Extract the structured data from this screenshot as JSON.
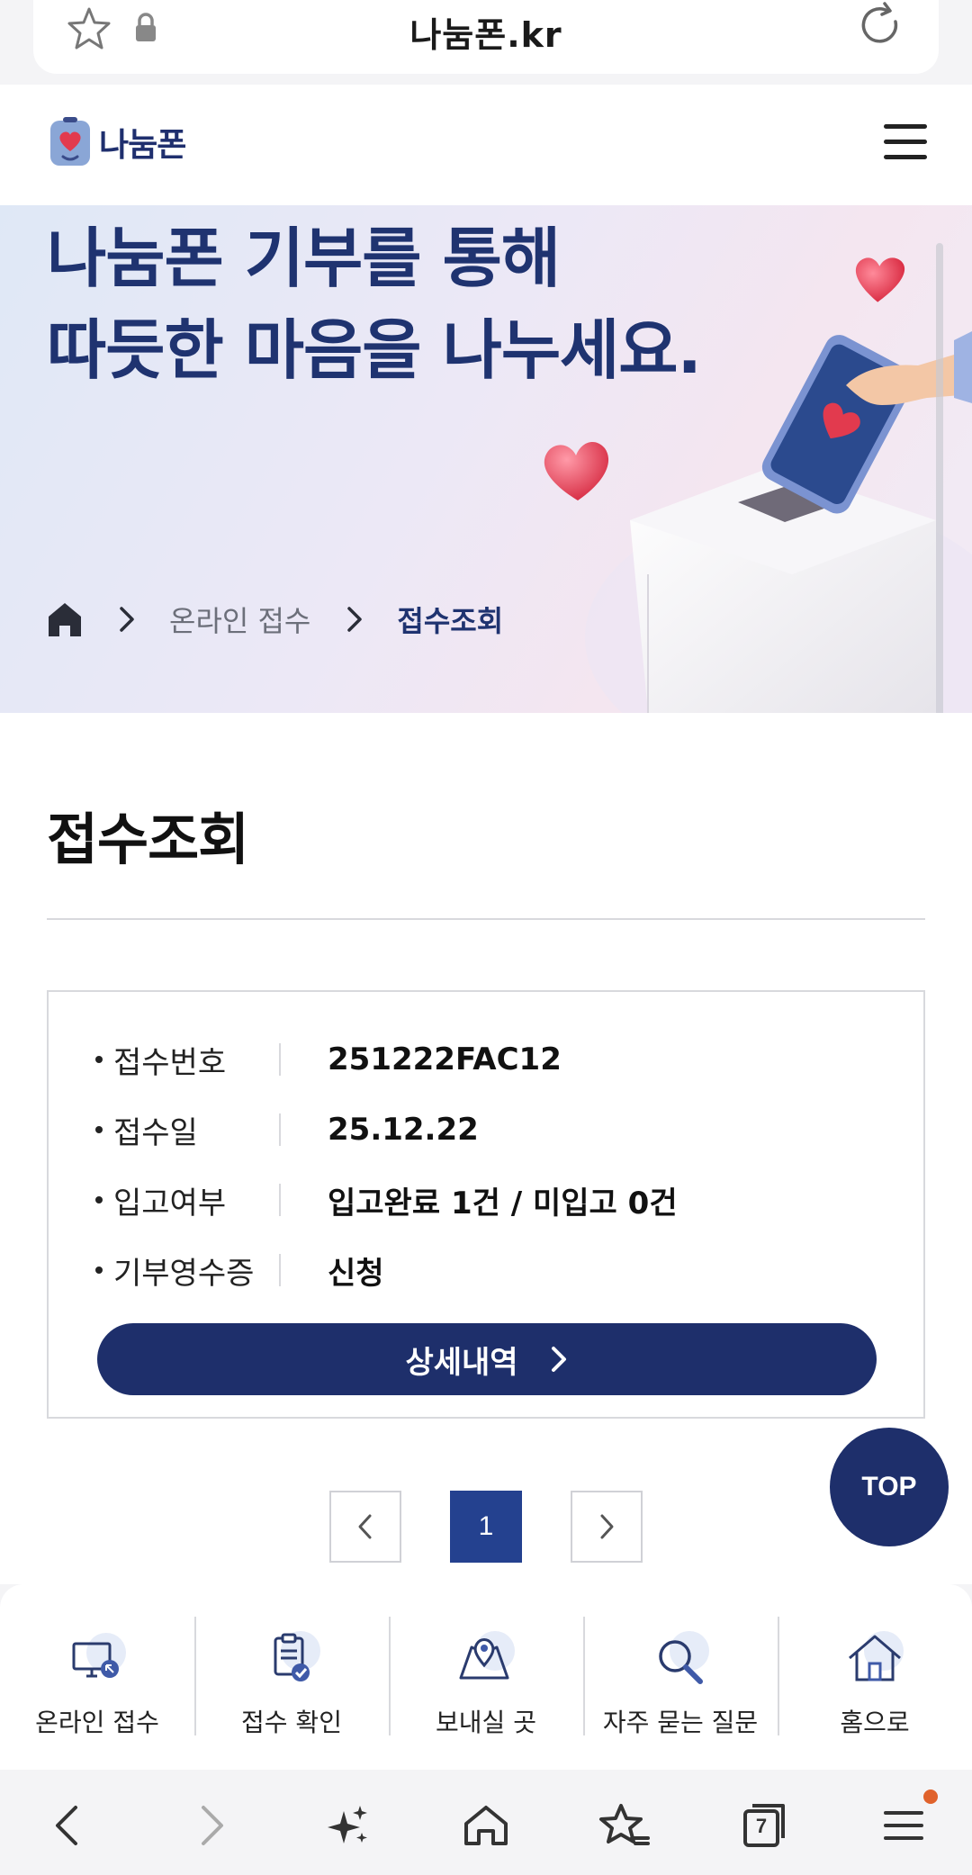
{
  "browser": {
    "url": "나눔폰.kr"
  },
  "header": {
    "logo_text": "나눔폰"
  },
  "hero": {
    "title_line1": "나눔폰 기부를 통해",
    "title_line2": "따듯한 마음을 나누세요.",
    "breadcrumb": [
      "온라인 접수",
      "접수조회"
    ]
  },
  "main": {
    "page_title": "접수조회",
    "rows": [
      {
        "key": "접수번호",
        "value": "251222FAC12"
      },
      {
        "key": "접수일",
        "value": "25.12.22"
      },
      {
        "key": "입고여부",
        "value": "입고완료 1건 / 미입고 0건"
      },
      {
        "key": "기부영수증",
        "value": "신청"
      }
    ],
    "detail_button": "상세내역",
    "top_button": "TOP",
    "pagination": {
      "current": "1"
    }
  },
  "quick_menu": [
    {
      "label": "온라인 접수",
      "icon": "monitor-icon"
    },
    {
      "label": "접수 확인",
      "icon": "clipboard-check-icon"
    },
    {
      "label": "보내실 곳",
      "icon": "map-pin-icon"
    },
    {
      "label": "자주 묻는 질문",
      "icon": "search-icon"
    },
    {
      "label": "홈으로",
      "icon": "house-icon"
    }
  ],
  "browser_nav": {
    "tab_count": "7"
  },
  "colors": {
    "primary": "#1e2f6b",
    "title": "#1f3370",
    "pagination_active": "#24418f",
    "notification": "#e0622c"
  }
}
